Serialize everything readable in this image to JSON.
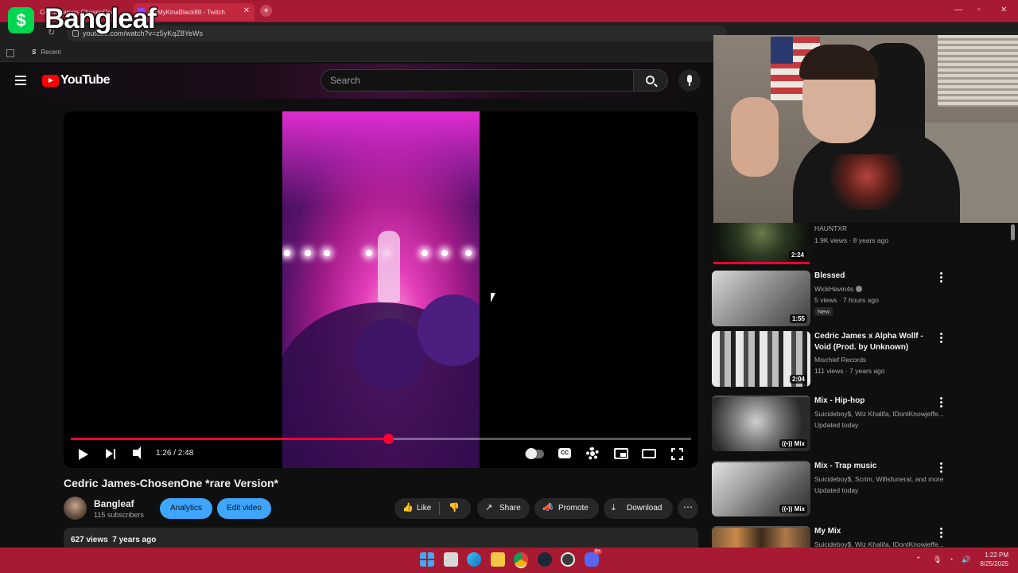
{
  "browser": {
    "tabs": [
      {
        "label": "Cedric James-ChosenOne",
        "active": false
      },
      {
        "label": "(3) MyKinaBlack88 - Twitch",
        "active": true
      }
    ],
    "url": "youtube.com/watch?v=z5yKqZ8YeWs",
    "bookmarks": [
      {
        "label": "Recent"
      }
    ]
  },
  "overlay": {
    "cash_symbol": "$",
    "cash_handle": "Bangleaf"
  },
  "youtube": {
    "logo_text": "YouTube",
    "search_placeholder": "Search",
    "player": {
      "current_time": "1:26",
      "duration": "2:48",
      "timecode": "1:26 / 2:48",
      "progress_fraction": 0.512,
      "cc_label": "CC"
    },
    "video": {
      "title": "Cedric James-ChosenOne *rare Version*",
      "channel": "Bangleaf",
      "subscribers": "115 subscribers",
      "analytics_label": "Analytics",
      "edit_label": "Edit video",
      "like_label": "Like",
      "share_label": "Share",
      "promote_label": "Promote",
      "download_label": "Download",
      "more_label": "⋯",
      "views": "627 views",
      "age": "7 years ago"
    },
    "recommendations": [
      {
        "title": "",
        "channel": "HAUNTXR",
        "meta": "1.9K views · 8 years ago",
        "duration": "2:24"
      },
      {
        "title": "Blessed",
        "channel": "WickHavin4s",
        "verified": true,
        "meta": "5 views · 7 hours ago",
        "badge": "New",
        "duration": "1:55"
      },
      {
        "title": "Cedric James x Alpha Wollf - Void (Prod. by Unknown)",
        "channel": "Mischief Records",
        "meta": "111 views · 7 years ago",
        "duration": "2:04"
      },
      {
        "title": "Mix - Hip-hop",
        "channel": "Suicideboy$, Wiz Khalifa, IDontKnowjeffe...",
        "meta": "Updated today",
        "duration": "Mix"
      },
      {
        "title": "Mix - Trap music",
        "channel": "Suicideboy$, Scrim, Wifisfuneral, and more",
        "meta": "Updated today",
        "duration": "Mix"
      },
      {
        "title": "My Mix",
        "channel": "Suicideboy$, Wiz Khalifa, IDontKnowjeffe...",
        "meta": "",
        "duration": ""
      }
    ]
  },
  "taskbar": {
    "time": "1:22 PM",
    "date": "8/25/2025",
    "notification_count": "9+"
  },
  "colors": {
    "accent_red": "#ff0033",
    "browser_frame": "#a81a33",
    "action_blue": "#3ea6ff",
    "cashapp_green": "#00d64f"
  }
}
